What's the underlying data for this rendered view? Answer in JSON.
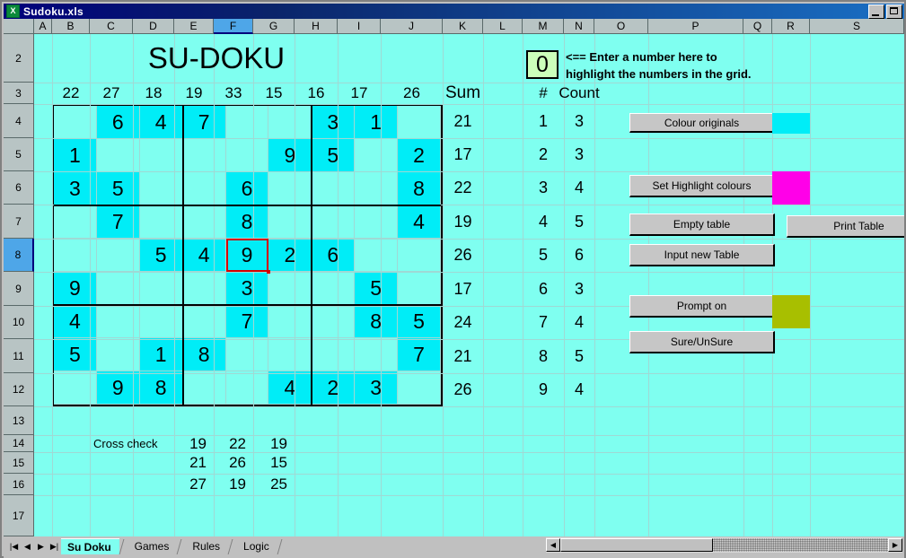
{
  "window": {
    "title": "Sudoku.xls",
    "icon": "excel-icon",
    "minimize_label": "_",
    "maximize_label": "□"
  },
  "sheet": {
    "column_headers": [
      "A",
      "B",
      "C",
      "D",
      "E",
      "F",
      "G",
      "H",
      "I",
      "J",
      "K",
      "L",
      "M",
      "N",
      "O",
      "P",
      "Q",
      "R",
      "S"
    ],
    "selected_column": "F",
    "row_headers": [
      "2",
      "3",
      "4",
      "5",
      "6",
      "7",
      "8",
      "9",
      "10",
      "11",
      "12",
      "13",
      "14",
      "15",
      "16",
      "17"
    ],
    "selected_row": "8"
  },
  "title_cell": "SU-DOKU",
  "highlight_input": {
    "value": "0",
    "instruction_line1": "<== Enter a number here to",
    "instruction_line2": "highlight the numbers in the grid."
  },
  "headers": {
    "sum": "Sum",
    "hash": "#",
    "count": "Count",
    "cross_check": "Cross check"
  },
  "column_sums": [
    22,
    27,
    18,
    19,
    33,
    15,
    16,
    17,
    26
  ],
  "row_sums": [
    21,
    17,
    22,
    19,
    26,
    17,
    24,
    21,
    26
  ],
  "number_counts": [
    {
      "number": "1",
      "count": "3"
    },
    {
      "number": "2",
      "count": "3"
    },
    {
      "number": "3",
      "count": "4"
    },
    {
      "number": "4",
      "count": "5"
    },
    {
      "number": "5",
      "count": "6"
    },
    {
      "number": "6",
      "count": "3"
    },
    {
      "number": "7",
      "count": "4"
    },
    {
      "number": "8",
      "count": "5"
    },
    {
      "number": "9",
      "count": "4"
    }
  ],
  "cross_check": [
    [
      19,
      22,
      19
    ],
    [
      21,
      26,
      15
    ],
    [
      27,
      19,
      25
    ]
  ],
  "grid": [
    [
      "",
      "6",
      "4",
      "7",
      "",
      "",
      "3",
      "1",
      ""
    ],
    [
      "1",
      "",
      "",
      "",
      "",
      "9",
      "5",
      "",
      "2"
    ],
    [
      "3",
      "5",
      "",
      "",
      "6",
      "",
      "",
      "",
      "8"
    ],
    [
      "",
      "7",
      "",
      "",
      "8",
      "",
      "",
      "",
      "4"
    ],
    [
      "",
      "",
      "5",
      "4",
      "9",
      "2",
      "6",
      "",
      ""
    ],
    [
      "9",
      "",
      "",
      "",
      "3",
      "",
      "",
      "5",
      ""
    ],
    [
      "4",
      "",
      "",
      "",
      "7",
      "",
      "",
      "8",
      "5"
    ],
    [
      "5",
      "",
      "1",
      "8",
      "",
      "",
      "",
      "",
      "7"
    ],
    [
      "",
      "9",
      "8",
      "",
      "",
      "4",
      "2",
      "3",
      ""
    ]
  ],
  "selected_cell": {
    "row": 4,
    "col": 4,
    "value": "9"
  },
  "buttons": [
    {
      "id": "colour-originals",
      "label": "Colour originals"
    },
    {
      "id": "set-highlight-colours",
      "label": "Set Highlight colours"
    },
    {
      "id": "empty-table",
      "label": "Empty table"
    },
    {
      "id": "print-table",
      "label": "Print Table"
    },
    {
      "id": "input-new-table",
      "label": "Input new Table"
    },
    {
      "id": "prompt-on",
      "label": "Prompt on"
    },
    {
      "id": "sure-unsure",
      "label": "Sure/UnSure"
    }
  ],
  "colors": {
    "cell_empty": "#7FFFF0",
    "cell_filled": "#00EDF7",
    "swatch_original": "#00EDF7",
    "swatch_highlight": "#FF00E8",
    "swatch_prompt": "#A8BF00",
    "input_cell_bg": "#CCFFBB",
    "selection_border": "#D40000"
  },
  "swatches": [
    {
      "id": "original-colour-swatch",
      "color": "#00EDF7"
    },
    {
      "id": "highlight-colour-swatch",
      "color": "#FF00E8"
    },
    {
      "id": "prompt-colour-swatch",
      "color": "#A8BF00"
    }
  ],
  "tabs": [
    {
      "label": "Su Doku",
      "active": true
    },
    {
      "label": "Games",
      "active": false
    },
    {
      "label": "Rules",
      "active": false
    },
    {
      "label": "Logic",
      "active": false
    }
  ],
  "tab_nav": [
    "|◀",
    "◀",
    "▶",
    "▶|"
  ],
  "scroll": {
    "left_arrow": "◀",
    "right_arrow": "▶"
  }
}
